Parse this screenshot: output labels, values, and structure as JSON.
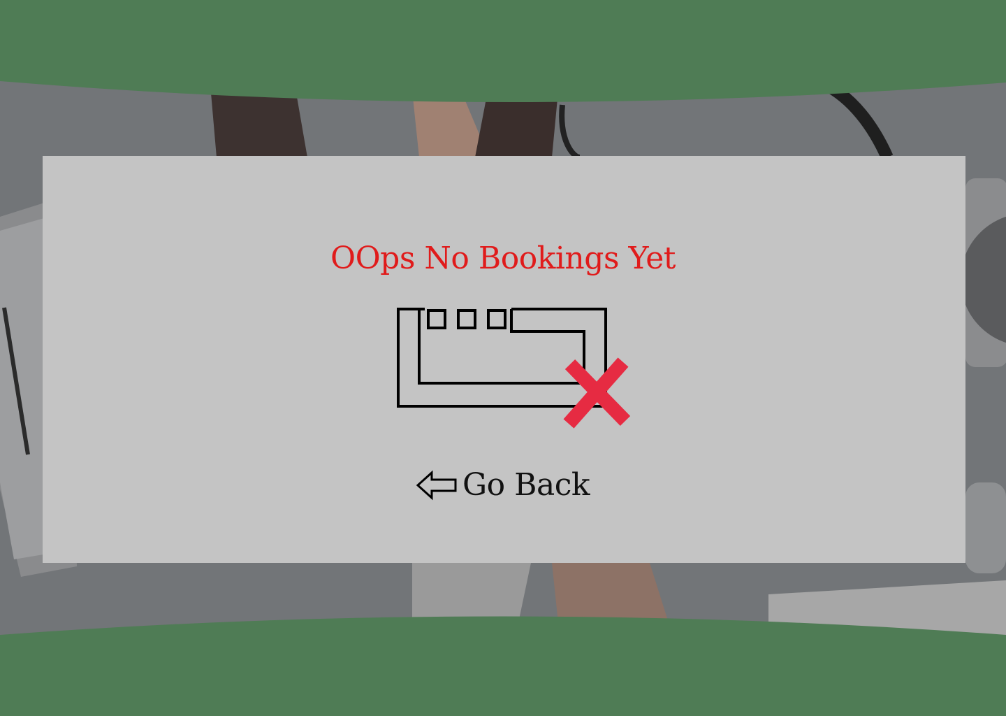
{
  "page": {
    "title": "OOps No Bookings Yet",
    "go_back_label": "Go Back"
  },
  "icons": {
    "empty_calendar": "empty-calendar-icon",
    "no_booking_mark": "x-mark-icon",
    "back_arrow": "arrow-left-icon"
  },
  "colors": {
    "band_green": "#4f7c55",
    "card_gray": "#c4c4c4",
    "title_red": "#e01b1b",
    "x_mark_red": "#e62b42",
    "text_dark": "#111111"
  }
}
